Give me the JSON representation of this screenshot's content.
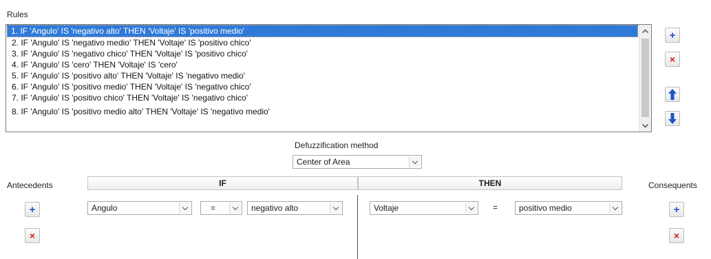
{
  "rules": {
    "label": "Rules",
    "items": [
      "1. IF 'Angulo' IS 'negativo alto' THEN 'Voltaje' IS 'positivo medio'",
      "2. IF 'Angulo' IS 'negativo medio' THEN 'Voltaje' IS 'positivo chico'",
      "3. IF 'Angulo' IS 'negativo chico' THEN 'Voltaje' IS 'positivo chico'",
      "4. IF 'Angulo' IS 'cero' THEN 'Voltaje' IS 'cero'",
      "5. IF 'Angulo' IS 'positivo alto' THEN 'Voltaje' IS 'negativo medio'",
      "6. IF 'Angulo' IS 'positivo medio' THEN 'Voltaje' IS 'negativo chico'",
      "7. IF 'Angulo' IS 'positivo chico' THEN 'Voltaje' IS 'negativo chico'",
      "8. IF 'Angulo' IS 'positivo medio alto' THEN 'Voltaje' IS 'negativo medio'"
    ],
    "selected_index": 0
  },
  "side_buttons": {
    "add_icon": "plus-icon",
    "delete_icon": "x-icon",
    "up_icon": "arrow-up-icon",
    "down_icon": "arrow-down-icon"
  },
  "defuzz": {
    "label": "Defuzzification method",
    "value": "Center of Area"
  },
  "antecedents": {
    "label": "Antecedents"
  },
  "consequents": {
    "label": "Consequents"
  },
  "headers": {
    "if": "IF",
    "then": "THEN"
  },
  "rule_editor": {
    "antecedent_variable": "Angulo",
    "antecedent_operator": "=",
    "antecedent_term": "negativo alto",
    "consequent_variable": "Voltaje",
    "consequent_operator": "=",
    "consequent_term": "positivo medio"
  },
  "colors": {
    "selection": "#2f7ad9",
    "add": "#2052c8",
    "delete": "#d21f1f"
  }
}
